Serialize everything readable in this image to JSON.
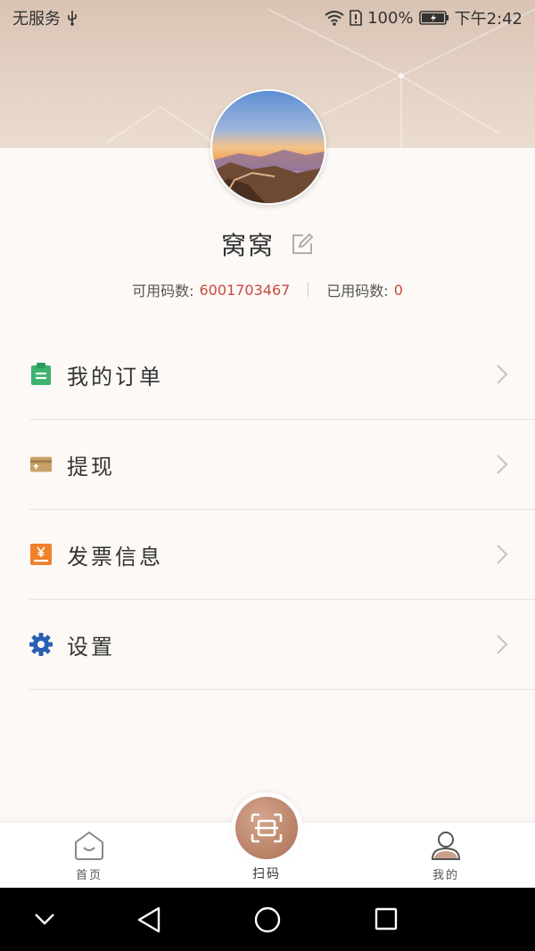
{
  "status_bar": {
    "carrier": "无服务",
    "battery": "100%",
    "time": "下午2:42"
  },
  "profile": {
    "username": "窝窝",
    "available_label": "可用码数:",
    "available_value": "6001703467",
    "used_label": "已用码数:",
    "used_value": "0"
  },
  "menu": {
    "items": [
      {
        "label": "我的订单",
        "icon": "clipboard-icon",
        "icon_color": "#3cb371"
      },
      {
        "label": "提现",
        "icon": "card-icon",
        "icon_color": "#c8a06a"
      },
      {
        "label": "发票信息",
        "icon": "invoice-icon",
        "icon_color": "#f0802a"
      },
      {
        "label": "设置",
        "icon": "gear-icon",
        "icon_color": "#2b5fb4"
      }
    ]
  },
  "bottom_nav": {
    "home_label": "首页",
    "scan_label": "扫码",
    "mine_label": "我的"
  },
  "colors": {
    "accent_value": "#c54a3f",
    "scan_button": "#b88065"
  }
}
